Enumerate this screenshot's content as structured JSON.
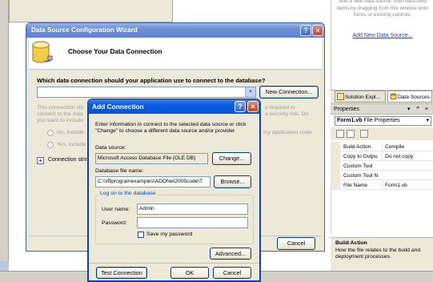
{
  "ide": {
    "data_sources_hint": "Add a new data source, then data-bind items by dragging from this window onto forms or existing controls.",
    "add_data_source_link": "Add New Data Source...",
    "tabs": {
      "solution_explorer": "Solution Expl...",
      "data_sources": "Data Sources"
    },
    "properties": {
      "title": "Properties",
      "controls": "▾ &#x2003;",
      "pin": "✶",
      "close": "×",
      "object": "Form1.vb",
      "object_type": "File Properties",
      "rows": [
        {
          "name": "Build Action",
          "value": "Compile"
        },
        {
          "name": "Copy to Outpu",
          "value": "Do not copy"
        },
        {
          "name": "Custom Tool",
          "value": ""
        },
        {
          "name": "Custom Tool N",
          "value": ""
        },
        {
          "name": "File Name",
          "value": "Form1.vb"
        }
      ],
      "desc_title": "Build Action",
      "desc_text": "How the file relates to the build and deployment processes."
    }
  },
  "wizard": {
    "title": "Data Source Configuration Wizard",
    "heading": "Choose Your Data Connection",
    "question": "Which data connection should your application use to connect to the database?",
    "new_connection": "New Connection...",
    "disabled_text_1": "This connection stri",
    "disabled_text_2": "connect to the data",
    "disabled_text_3": "you want to include",
    "disabled_right_1": "s required to",
    "disabled_right_2": "a security risk. Do",
    "option_no": "No, include",
    "option_no_right": "my application code.",
    "option_yes": "Yes, include",
    "connection_string": "Connection strin",
    "cancel": "Cancel"
  },
  "add_connection": {
    "title": "Add Connection",
    "intro": "Enter information to connect to the selected data source or click \"Change\" to choose a different data source and/or provider.",
    "data_source_label": "Data source:",
    "data_source_value": "Microsoft Access Database File (OLE DB)",
    "change_button": "Change...",
    "db_file_label": "Database file name:",
    "db_file_value": "C:\\VBprogramexamples\\ADONet2005code\\T",
    "browse_button": "Browse...",
    "logon_group": "Log on to the database",
    "username_label": "User name:",
    "username_value": "Admin",
    "password_label": "Password:",
    "password_value": "",
    "save_password": "Save my password",
    "advanced_button": "Advanced...",
    "test_button": "Test Connection",
    "ok_button": "OK",
    "cancel_button": "Cancel"
  }
}
